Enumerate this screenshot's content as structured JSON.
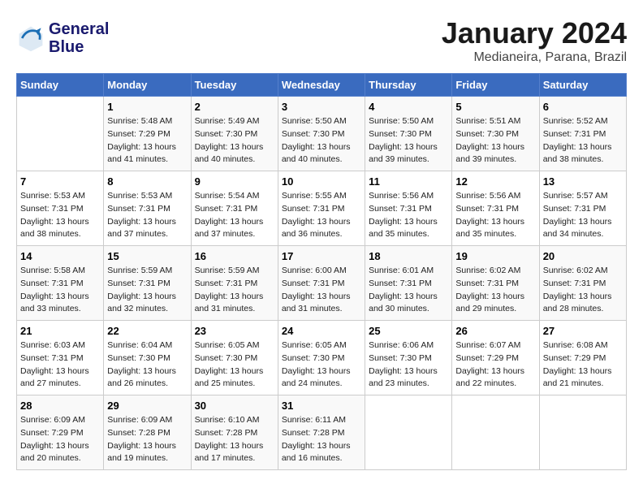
{
  "header": {
    "logo_line1": "General",
    "logo_line2": "Blue",
    "title": "January 2024",
    "subtitle": "Medianeira, Parana, Brazil"
  },
  "calendar": {
    "days_of_week": [
      "Sunday",
      "Monday",
      "Tuesday",
      "Wednesday",
      "Thursday",
      "Friday",
      "Saturday"
    ],
    "weeks": [
      [
        {
          "day": "",
          "info": ""
        },
        {
          "day": "1",
          "info": "Sunrise: 5:48 AM\nSunset: 7:29 PM\nDaylight: 13 hours\nand 41 minutes."
        },
        {
          "day": "2",
          "info": "Sunrise: 5:49 AM\nSunset: 7:30 PM\nDaylight: 13 hours\nand 40 minutes."
        },
        {
          "day": "3",
          "info": "Sunrise: 5:50 AM\nSunset: 7:30 PM\nDaylight: 13 hours\nand 40 minutes."
        },
        {
          "day": "4",
          "info": "Sunrise: 5:50 AM\nSunset: 7:30 PM\nDaylight: 13 hours\nand 39 minutes."
        },
        {
          "day": "5",
          "info": "Sunrise: 5:51 AM\nSunset: 7:30 PM\nDaylight: 13 hours\nand 39 minutes."
        },
        {
          "day": "6",
          "info": "Sunrise: 5:52 AM\nSunset: 7:31 PM\nDaylight: 13 hours\nand 38 minutes."
        }
      ],
      [
        {
          "day": "7",
          "info": "Sunrise: 5:53 AM\nSunset: 7:31 PM\nDaylight: 13 hours\nand 38 minutes."
        },
        {
          "day": "8",
          "info": "Sunrise: 5:53 AM\nSunset: 7:31 PM\nDaylight: 13 hours\nand 37 minutes."
        },
        {
          "day": "9",
          "info": "Sunrise: 5:54 AM\nSunset: 7:31 PM\nDaylight: 13 hours\nand 37 minutes."
        },
        {
          "day": "10",
          "info": "Sunrise: 5:55 AM\nSunset: 7:31 PM\nDaylight: 13 hours\nand 36 minutes."
        },
        {
          "day": "11",
          "info": "Sunrise: 5:56 AM\nSunset: 7:31 PM\nDaylight: 13 hours\nand 35 minutes."
        },
        {
          "day": "12",
          "info": "Sunrise: 5:56 AM\nSunset: 7:31 PM\nDaylight: 13 hours\nand 35 minutes."
        },
        {
          "day": "13",
          "info": "Sunrise: 5:57 AM\nSunset: 7:31 PM\nDaylight: 13 hours\nand 34 minutes."
        }
      ],
      [
        {
          "day": "14",
          "info": "Sunrise: 5:58 AM\nSunset: 7:31 PM\nDaylight: 13 hours\nand 33 minutes."
        },
        {
          "day": "15",
          "info": "Sunrise: 5:59 AM\nSunset: 7:31 PM\nDaylight: 13 hours\nand 32 minutes."
        },
        {
          "day": "16",
          "info": "Sunrise: 5:59 AM\nSunset: 7:31 PM\nDaylight: 13 hours\nand 31 minutes."
        },
        {
          "day": "17",
          "info": "Sunrise: 6:00 AM\nSunset: 7:31 PM\nDaylight: 13 hours\nand 31 minutes."
        },
        {
          "day": "18",
          "info": "Sunrise: 6:01 AM\nSunset: 7:31 PM\nDaylight: 13 hours\nand 30 minutes."
        },
        {
          "day": "19",
          "info": "Sunrise: 6:02 AM\nSunset: 7:31 PM\nDaylight: 13 hours\nand 29 minutes."
        },
        {
          "day": "20",
          "info": "Sunrise: 6:02 AM\nSunset: 7:31 PM\nDaylight: 13 hours\nand 28 minutes."
        }
      ],
      [
        {
          "day": "21",
          "info": "Sunrise: 6:03 AM\nSunset: 7:31 PM\nDaylight: 13 hours\nand 27 minutes."
        },
        {
          "day": "22",
          "info": "Sunrise: 6:04 AM\nSunset: 7:30 PM\nDaylight: 13 hours\nand 26 minutes."
        },
        {
          "day": "23",
          "info": "Sunrise: 6:05 AM\nSunset: 7:30 PM\nDaylight: 13 hours\nand 25 minutes."
        },
        {
          "day": "24",
          "info": "Sunrise: 6:05 AM\nSunset: 7:30 PM\nDaylight: 13 hours\nand 24 minutes."
        },
        {
          "day": "25",
          "info": "Sunrise: 6:06 AM\nSunset: 7:30 PM\nDaylight: 13 hours\nand 23 minutes."
        },
        {
          "day": "26",
          "info": "Sunrise: 6:07 AM\nSunset: 7:29 PM\nDaylight: 13 hours\nand 22 minutes."
        },
        {
          "day": "27",
          "info": "Sunrise: 6:08 AM\nSunset: 7:29 PM\nDaylight: 13 hours\nand 21 minutes."
        }
      ],
      [
        {
          "day": "28",
          "info": "Sunrise: 6:09 AM\nSunset: 7:29 PM\nDaylight: 13 hours\nand 20 minutes."
        },
        {
          "day": "29",
          "info": "Sunrise: 6:09 AM\nSunset: 7:28 PM\nDaylight: 13 hours\nand 19 minutes."
        },
        {
          "day": "30",
          "info": "Sunrise: 6:10 AM\nSunset: 7:28 PM\nDaylight: 13 hours\nand 17 minutes."
        },
        {
          "day": "31",
          "info": "Sunrise: 6:11 AM\nSunset: 7:28 PM\nDaylight: 13 hours\nand 16 minutes."
        },
        {
          "day": "",
          "info": ""
        },
        {
          "day": "",
          "info": ""
        },
        {
          "day": "",
          "info": ""
        }
      ]
    ]
  }
}
